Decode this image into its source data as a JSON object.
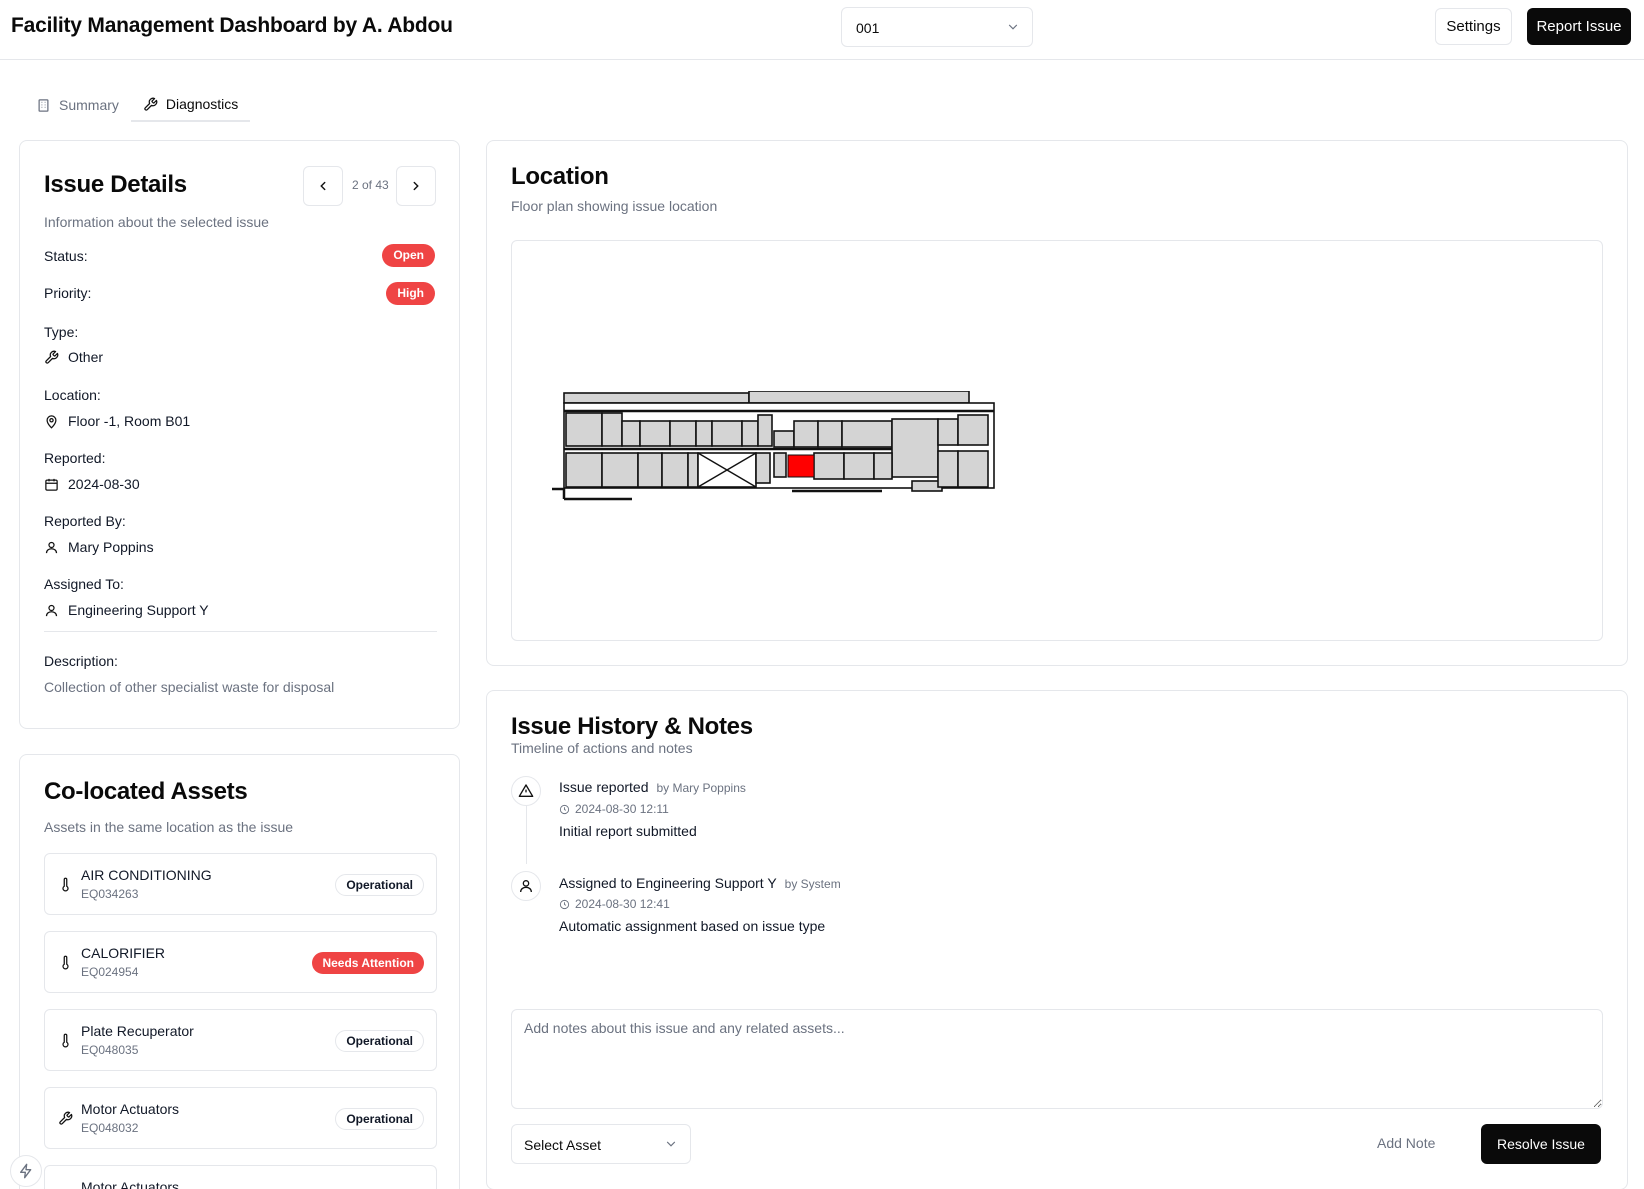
{
  "header": {
    "title": "Facility Management Dashboard by A. Abdou",
    "building_value": "001",
    "settings_label": "Settings",
    "report_label": "Report Issue"
  },
  "tabs": [
    {
      "label": "Summary",
      "icon": "building-icon",
      "active": false
    },
    {
      "label": "Diagnostics",
      "icon": "wrench-icon",
      "active": true
    }
  ],
  "issue": {
    "title": "Issue Details",
    "subtitle": "Information about the selected issue",
    "pager": "2 of 43",
    "status_label": "Status:",
    "status": "Open",
    "priority_label": "Priority:",
    "priority": "High",
    "type_label": "Type:",
    "type": "Other",
    "location_label": "Location:",
    "location": "Floor -1, Room B01",
    "reported_label": "Reported:",
    "reported": "2024-08-30",
    "reported_by_label": "Reported By:",
    "reported_by": "Mary Poppins",
    "assigned_label": "Assigned To:",
    "assigned": "Engineering Support Y",
    "description_label": "Description:",
    "description": "Collection of other specialist waste for disposal",
    "badge_color": "#ef4444"
  },
  "assets": {
    "title": "Co-located Assets",
    "subtitle": "Assets in the same location as the issue",
    "items": [
      {
        "name": "AIR CONDITIONING",
        "code": "EQ034263",
        "status": "Operational",
        "icon": "thermometer-icon"
      },
      {
        "name": "CALORIFIER",
        "code": "EQ024954",
        "status": "Needs Attention",
        "icon": "thermometer-icon"
      },
      {
        "name": "Plate Recuperator",
        "code": "EQ048035",
        "status": "Operational",
        "icon": "thermometer-icon"
      },
      {
        "name": "Motor Actuators",
        "code": "EQ048032",
        "status": "Operational",
        "icon": "wrench-icon"
      },
      {
        "name": "Motor Actuators",
        "code": "",
        "status": "",
        "icon": "wrench-icon"
      }
    ]
  },
  "location": {
    "title": "Location",
    "subtitle": "Floor plan showing issue location",
    "highlight_color": "#ff0000"
  },
  "history": {
    "title": "Issue History & Notes",
    "subtitle": "Timeline of actions and notes",
    "events": [
      {
        "title": "Issue reported",
        "by": "by Mary Poppins",
        "time": "2024-08-30 12:11",
        "desc": "Initial report submitted",
        "icon": "alert-triangle-icon"
      },
      {
        "title": "Assigned to Engineering Support Y",
        "by": "by System",
        "time": "2024-08-30 12:41",
        "desc": "Automatic assignment based on issue type",
        "icon": "user-icon"
      }
    ],
    "notes_placeholder": "Add notes about this issue and any related assets...",
    "select_asset": "Select Asset",
    "add_note": "Add Note",
    "resolve": "Resolve Issue"
  }
}
